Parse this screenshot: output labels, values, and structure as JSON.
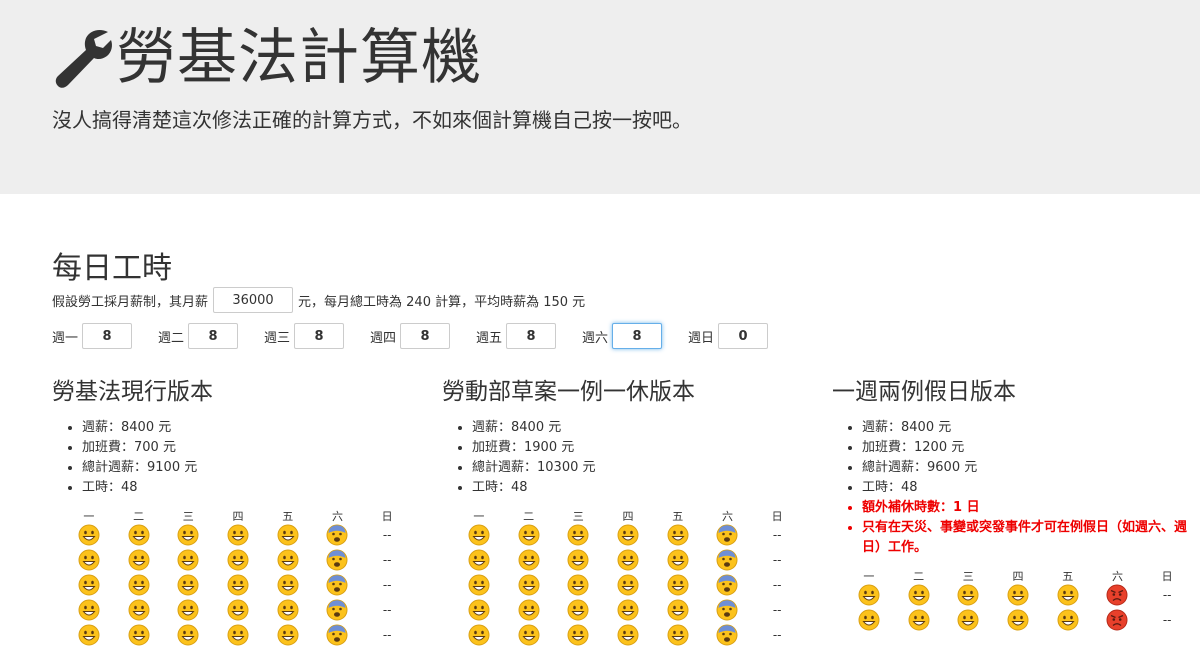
{
  "header": {
    "title": "勞基法計算機",
    "subtitle": "沒人搞得清楚這次修法正確的計算方式，不如來個計算機自己按一按吧。"
  },
  "section": {
    "title": "每日工時",
    "salary_prefix": "假設勞工採月薪制，其月薪",
    "salary_value": "36000",
    "salary_suffix": "元，每月總工時為 240 計算，平均時薪為 150 元"
  },
  "days": [
    {
      "label": "週一",
      "value": "8"
    },
    {
      "label": "週二",
      "value": "8"
    },
    {
      "label": "週三",
      "value": "8"
    },
    {
      "label": "週四",
      "value": "8"
    },
    {
      "label": "週五",
      "value": "8"
    },
    {
      "label": "週六",
      "value": "8"
    },
    {
      "label": "週日",
      "value": "0"
    }
  ],
  "grid_headers": [
    "一",
    "二",
    "三",
    "四",
    "五",
    "六",
    "日"
  ],
  "empty_mark": "--",
  "icons": {
    "happy": "grinning-face-icon",
    "fearful": "fearful-face-icon",
    "angry": "angry-face-icon"
  },
  "columns": [
    {
      "title": "勞基法現行版本",
      "facts": [
        {
          "text": "週薪：8400 元",
          "warn": false
        },
        {
          "text": "加班費：700 元",
          "warn": false
        },
        {
          "text": "總計週薪：9100 元",
          "warn": false
        },
        {
          "text": "工時：48",
          "warn": false
        }
      ],
      "rows": [
        [
          "happy",
          "happy",
          "happy",
          "happy",
          "happy",
          "fearful",
          "--"
        ],
        [
          "happy",
          "happy",
          "happy",
          "happy",
          "happy",
          "fearful",
          "--"
        ],
        [
          "happy",
          "happy",
          "happy",
          "happy",
          "happy",
          "fearful",
          "--"
        ],
        [
          "happy",
          "happy",
          "happy",
          "happy",
          "happy",
          "fearful",
          "--"
        ],
        [
          "happy",
          "happy",
          "happy",
          "happy",
          "happy",
          "fearful",
          "--"
        ]
      ]
    },
    {
      "title": "勞動部草案一例一休版本",
      "facts": [
        {
          "text": "週薪：8400 元",
          "warn": false
        },
        {
          "text": "加班費：1900 元",
          "warn": false
        },
        {
          "text": "總計週薪：10300 元",
          "warn": false
        },
        {
          "text": "工時：48",
          "warn": false
        }
      ],
      "rows": [
        [
          "happy",
          "happy",
          "happy",
          "happy",
          "happy",
          "fearful",
          "--"
        ],
        [
          "happy",
          "happy",
          "happy",
          "happy",
          "happy",
          "fearful",
          "--"
        ],
        [
          "happy",
          "happy",
          "happy",
          "happy",
          "happy",
          "fearful",
          "--"
        ],
        [
          "happy",
          "happy",
          "happy",
          "happy",
          "happy",
          "fearful",
          "--"
        ],
        [
          "happy",
          "happy",
          "happy",
          "happy",
          "happy",
          "fearful",
          "--"
        ]
      ]
    },
    {
      "title": "一週兩例假日版本",
      "facts": [
        {
          "text": "週薪：8400 元",
          "warn": false
        },
        {
          "text": "加班費：1200 元",
          "warn": false
        },
        {
          "text": "總計週薪：9600 元",
          "warn": false
        },
        {
          "text": "工時：48",
          "warn": false
        },
        {
          "text": "額外補休時數：1 日",
          "warn": true
        },
        {
          "text": "只有在天災、事變或突發事件才可在例假日（如週六、週日）工作。",
          "warn": true
        }
      ],
      "rows": [
        [
          "happy",
          "happy",
          "happy",
          "happy",
          "happy",
          "angry",
          "--"
        ],
        [
          "happy",
          "happy",
          "happy",
          "happy",
          "happy",
          "angry",
          "--"
        ]
      ]
    }
  ]
}
